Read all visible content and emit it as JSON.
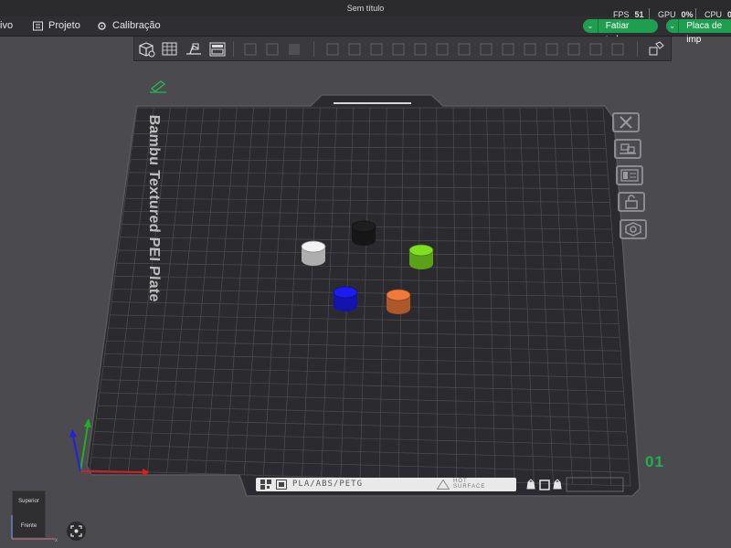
{
  "window": {
    "title": "Sem título"
  },
  "menu": [
    {
      "label": "ivo",
      "icon": "none"
    },
    {
      "label": "Projeto",
      "icon": "project-icon"
    },
    {
      "label": "Calibração",
      "icon": "calibration-icon"
    }
  ],
  "stats": {
    "fps_label": "FPS",
    "fps_value": "51",
    "gpu_label": "GPU",
    "gpu_value": "0%",
    "cpu_label": "CPU",
    "cpu_value": "0"
  },
  "actions": {
    "slice_all": "Fatiar tudo",
    "print_plate": "Placa de imp"
  },
  "plate": {
    "name": "Bambu Textured PEI Plate",
    "number": "01",
    "filament_tag": "PLA/ABS/PETG",
    "hot_surface": [
      "HOT",
      "SURFACE"
    ]
  },
  "objects": [
    {
      "name": "white-cylinder",
      "color": "#f2f2f2"
    },
    {
      "name": "black-cylinder",
      "color": "#1e1e1e"
    },
    {
      "name": "green-cylinder",
      "color": "#7ee021"
    },
    {
      "name": "blue-cylinder",
      "color": "#1c1cf0"
    },
    {
      "name": "orange-cylinder",
      "color": "#f07a3a"
    }
  ],
  "viewcube": {
    "top": "Superior",
    "front": "Frente"
  },
  "colors": {
    "accent": "#1e9e4f",
    "plate": "#2b2b2f",
    "background": "#4a4a4f"
  }
}
